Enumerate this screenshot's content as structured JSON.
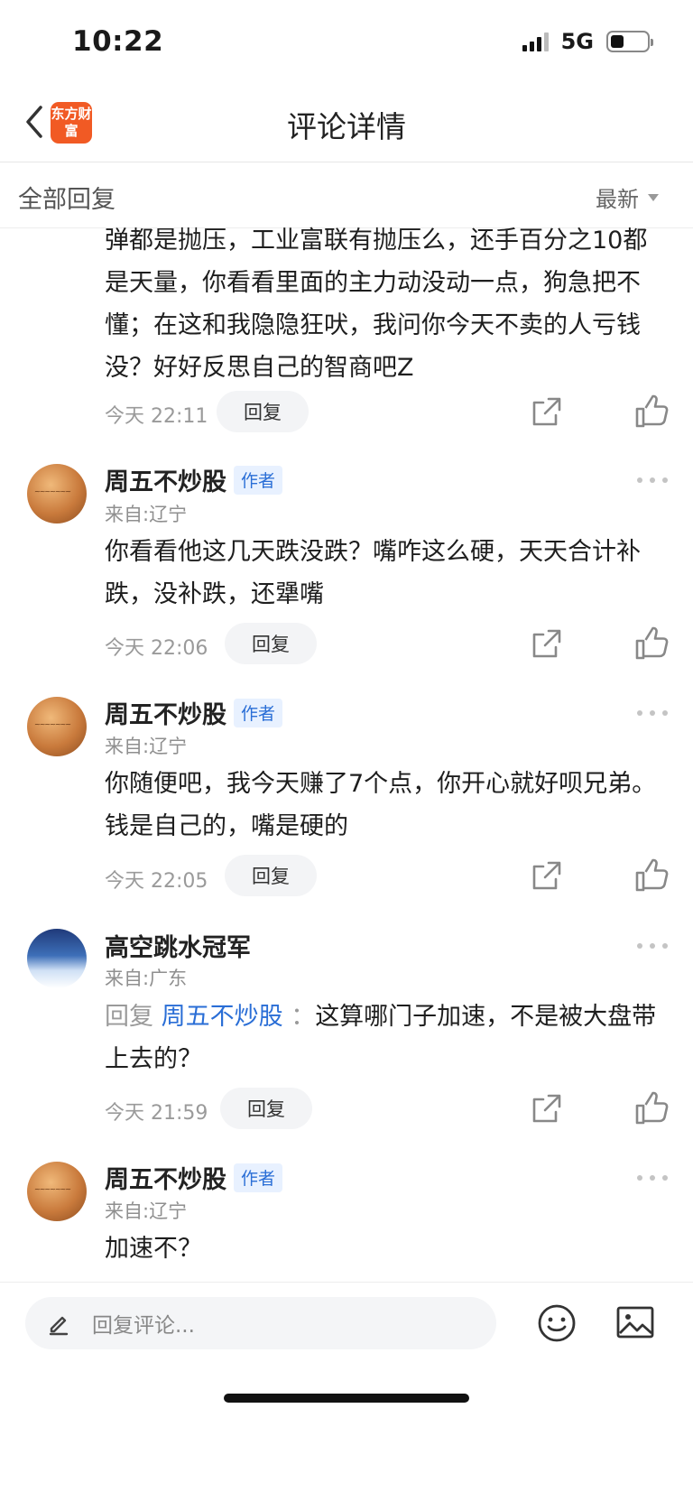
{
  "status": {
    "time": "10:22",
    "network": "5G"
  },
  "nav": {
    "logo_text": "东方财富",
    "title": "评论详情"
  },
  "filter": {
    "label": "全部回复",
    "sort": "最新"
  },
  "comments": [
    {
      "text": "弹都是抛压，工业富联有抛压么，还手百分之10都是天量，你看看里面的主力动没动一点，狗急把不懂；在这和我隐隐狂吠，我问你今天不卖的人亏钱没？好好反思自己的智商吧Z",
      "time": "今天 22:11",
      "reply_label": "回复"
    },
    {
      "user": "周五不炒股",
      "tag": "作者",
      "location": "来自:辽宁",
      "text": "你看看他这几天跌没跌？嘴咋这么硬，天天合计补跌，没补跌，还犟嘴",
      "time": "今天 22:06",
      "reply_label": "回复"
    },
    {
      "user": "周五不炒股",
      "tag": "作者",
      "location": "来自:辽宁",
      "text": "你随便吧，我今天赚了7个点，你开心就好呗兄弟。钱是自己的，嘴是硬的",
      "time": "今天 22:05",
      "reply_label": "回复"
    },
    {
      "user": "高空跳水冠军",
      "location": "来自:广东",
      "reply_prefix": "回复",
      "reply_target": "周五不炒股",
      "reply_colon": "：",
      "text": "这算哪门子加速，不是被大盘带上去的？",
      "time": "今天 21:59",
      "reply_label": "回复"
    },
    {
      "user": "周五不炒股",
      "tag": "作者",
      "location": "来自:辽宁",
      "text": "加速不？"
    }
  ],
  "bottom": {
    "placeholder": "回复评论..."
  },
  "colors": {
    "brand": "#f15a24",
    "link": "#2a6ed6",
    "tag_bg": "#e8f1ff"
  },
  "icons": [
    "chevron-left-icon",
    "share-icon",
    "thumbs-up-icon",
    "more-icon",
    "pencil-icon",
    "emoji-icon",
    "image-icon"
  ]
}
